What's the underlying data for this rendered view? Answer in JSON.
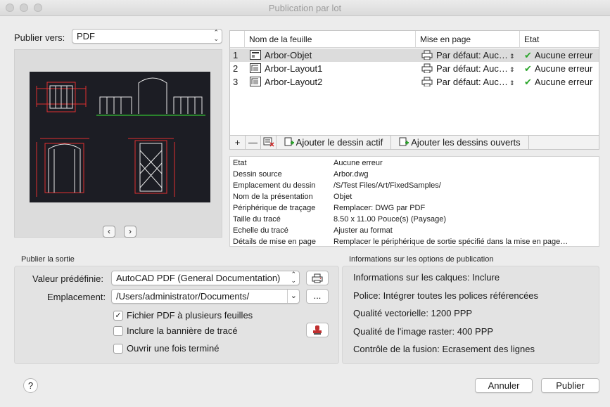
{
  "window": {
    "title": "Publication par lot"
  },
  "publish_to": {
    "label": "Publier vers:",
    "value": "PDF"
  },
  "preview": {
    "prev_label": "‹",
    "next_label": "›"
  },
  "sheet_table": {
    "headers": {
      "name": "Nom de la feuille",
      "page_setup": "Mise en page",
      "state": "Etat"
    },
    "rows": [
      {
        "num": "1",
        "name": "Arbor-Objet",
        "page_setup": "Par défaut: Auc…",
        "state": "Aucune erreur"
      },
      {
        "num": "2",
        "name": "Arbor-Layout1",
        "page_setup": "Par défaut: Auc…",
        "state": "Aucune erreur"
      },
      {
        "num": "3",
        "name": "Arbor-Layout2",
        "page_setup": "Par défaut: Auc…",
        "state": "Aucune erreur"
      }
    ]
  },
  "toolbar": {
    "add_label": "+",
    "remove_label": "—",
    "add_active": "Ajouter le dessin actif",
    "add_open": "Ajouter les dessins ouverts"
  },
  "properties": [
    {
      "key": "Etat",
      "value": "Aucune erreur"
    },
    {
      "key": "Dessin source",
      "value": "Arbor.dwg"
    },
    {
      "key": "Emplacement du dessin",
      "value": "/S/Test Files/Art/FixedSamples/"
    },
    {
      "key": "Nom de la présentation",
      "value": "Objet"
    },
    {
      "key": "Périphérique de traçage",
      "value": "Remplacer: DWG par PDF"
    },
    {
      "key": "Taille du tracé",
      "value": "8.50 x 11.00 Pouce(s) (Paysage)"
    },
    {
      "key": "Echelle du tracé",
      "value": "Ajuster au format"
    },
    {
      "key": "Détails de mise en page",
      "value": "Remplacer le périphérique de sortie spécifié dans la mise en page…"
    }
  ],
  "output": {
    "title": "Publier la sortie",
    "preset_label": "Valeur prédéfinie:",
    "preset_value": "AutoCAD PDF (General Documentation)",
    "location_label": "Emplacement:",
    "location_value": "/Users/administrator/Documents/",
    "browse_label": "...",
    "multi_sheet": {
      "label": "Fichier PDF à plusieurs feuilles",
      "checked": true,
      "mark": "✓"
    },
    "plot_stamp": {
      "label": "Inclure la bannière de tracé",
      "checked": false
    },
    "open_after": {
      "label": "Ouvrir une fois terminé",
      "checked": false
    }
  },
  "publish_info": {
    "title": "Informations sur les options de publication",
    "items": [
      "Informations sur les calques: Inclure",
      "Police: Intégrer toutes les polices référencées",
      "Qualité vectorielle: 1200 PPP",
      "Qualité de l'image raster: 400 PPP",
      "Contrôle de la fusion: Ecrasement des lignes"
    ]
  },
  "buttons": {
    "help": "?",
    "cancel": "Annuler",
    "publish": "Publier"
  },
  "colors": {
    "selected_row": "#dcdcdc",
    "check_green": "#2aa52a",
    "drawing_bg": "#1c1d24"
  }
}
